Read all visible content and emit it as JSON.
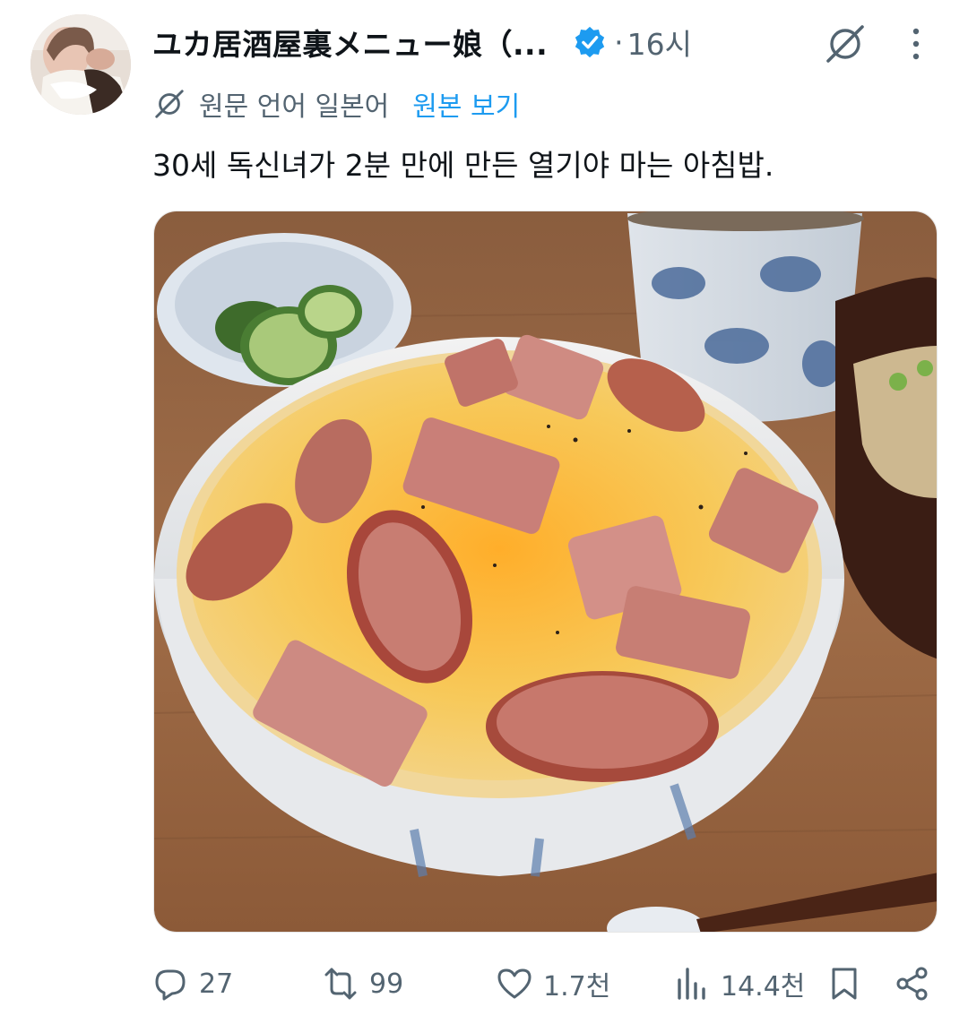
{
  "author": {
    "display_name": "ユカ居酒屋裏メニュー娘（...",
    "verified_icon": "verified-badge-icon",
    "dot": "·",
    "time": "16시"
  },
  "translation": {
    "label": "원문 언어 일본어",
    "show_original": "원본 보기"
  },
  "tweet": {
    "text": "30세 독신녀가 2분 만에 만든 열기야 마는 아침밥."
  },
  "actions": {
    "replies": "27",
    "reposts": "99",
    "likes": "1.7천",
    "views": "14.4천"
  },
  "colors": {
    "accent": "#1d9bf0",
    "muted": "#536471",
    "text": "#0f1419"
  }
}
